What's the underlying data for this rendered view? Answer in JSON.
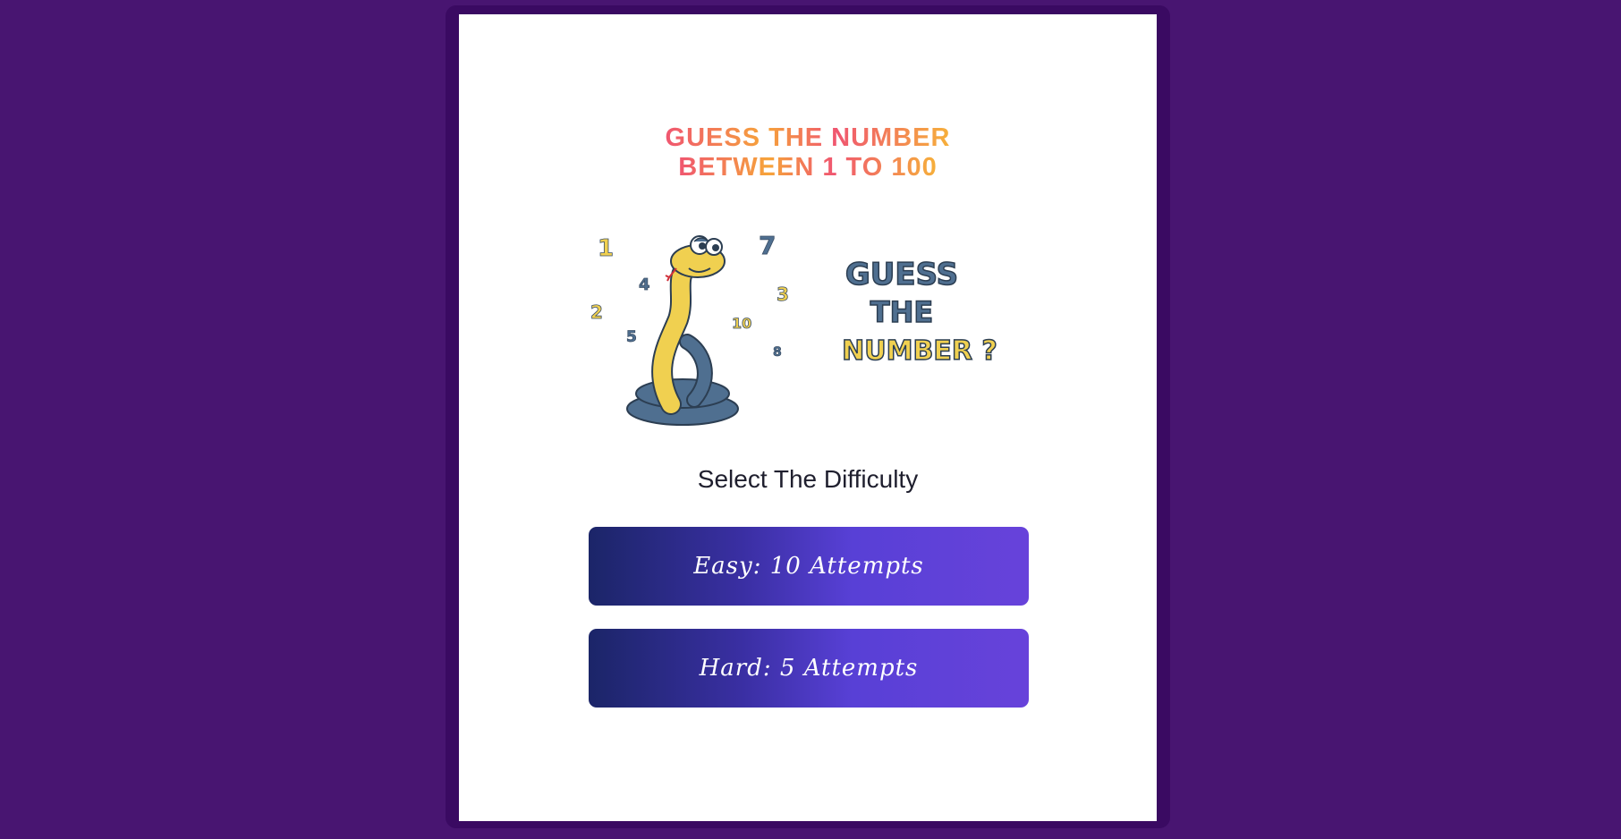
{
  "headline": {
    "line1": "GUESS THE NUMBER",
    "line2": "BETWEEN 1 TO 100"
  },
  "logo": {
    "scattered_numbers": [
      "1",
      "7",
      "4",
      "3",
      "2",
      "10",
      "5",
      "8"
    ],
    "word1": "GUESS",
    "word2": "THE",
    "word3": "NUMBER ?"
  },
  "subtitle": "Select The Difficulty",
  "buttons": {
    "easy": "Easy: 10 Attempts",
    "hard": "Hard: 5 Attempts"
  },
  "colors": {
    "page_background": "#481571",
    "frame": "#3a0a62",
    "card": "#ffffff",
    "headline_gradient": [
      "#f05670",
      "#f6a43a"
    ],
    "button_gradient": [
      "#1b2568",
      "#6742da"
    ],
    "logo_blue": "#4f6f90",
    "logo_yellow": "#f0d050"
  }
}
